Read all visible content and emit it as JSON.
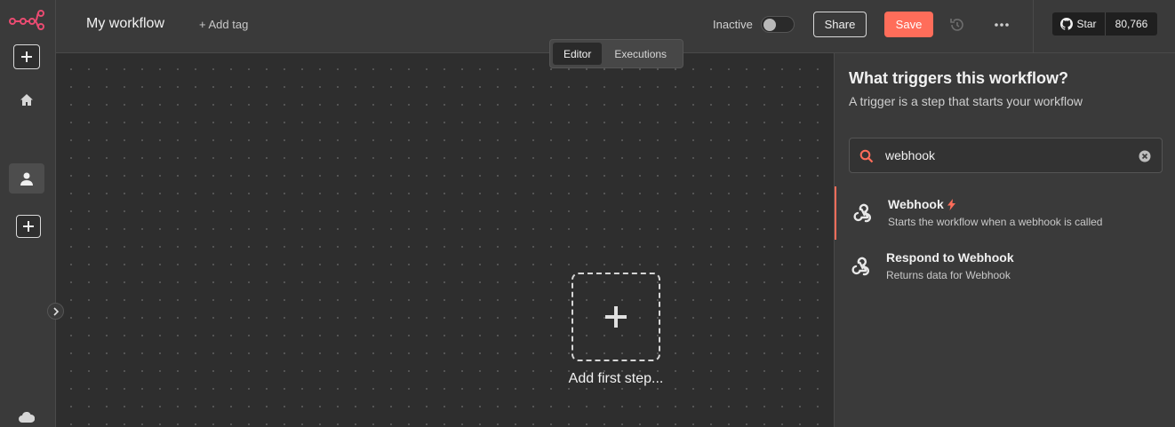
{
  "header": {
    "workflow_name": "My workflow",
    "add_tag": "+ Add tag",
    "status_label": "Inactive",
    "share_label": "Share",
    "save_label": "Save",
    "github": {
      "star_label": "Star",
      "star_count": "80,766"
    }
  },
  "tabs": [
    {
      "label": "Editor",
      "active": true
    },
    {
      "label": "Executions",
      "active": false
    }
  ],
  "canvas": {
    "add_first_step": "Add first step..."
  },
  "panel": {
    "title": "What triggers this workflow?",
    "subtitle": "A trigger is a step that starts your workflow",
    "search": {
      "value": "webhook"
    },
    "nodes": [
      {
        "name": "Webhook",
        "description": "Starts the workflow when a webhook is called",
        "icon": "webhook-icon",
        "badge": "bolt-icon",
        "selected": true
      },
      {
        "name": "Respond to Webhook",
        "description": "Returns data for Webhook",
        "icon": "webhook-icon",
        "selected": false
      }
    ]
  },
  "colors": {
    "accent": "#ff6d5a",
    "background": "#2e2e2e",
    "sidebar": "#3a3a3a"
  },
  "sidebar_icons": [
    "n8n-logo",
    "add-icon",
    "home-icon",
    "user-icon",
    "add-icon",
    "cloud-icon",
    "chevron-right-icon"
  ]
}
